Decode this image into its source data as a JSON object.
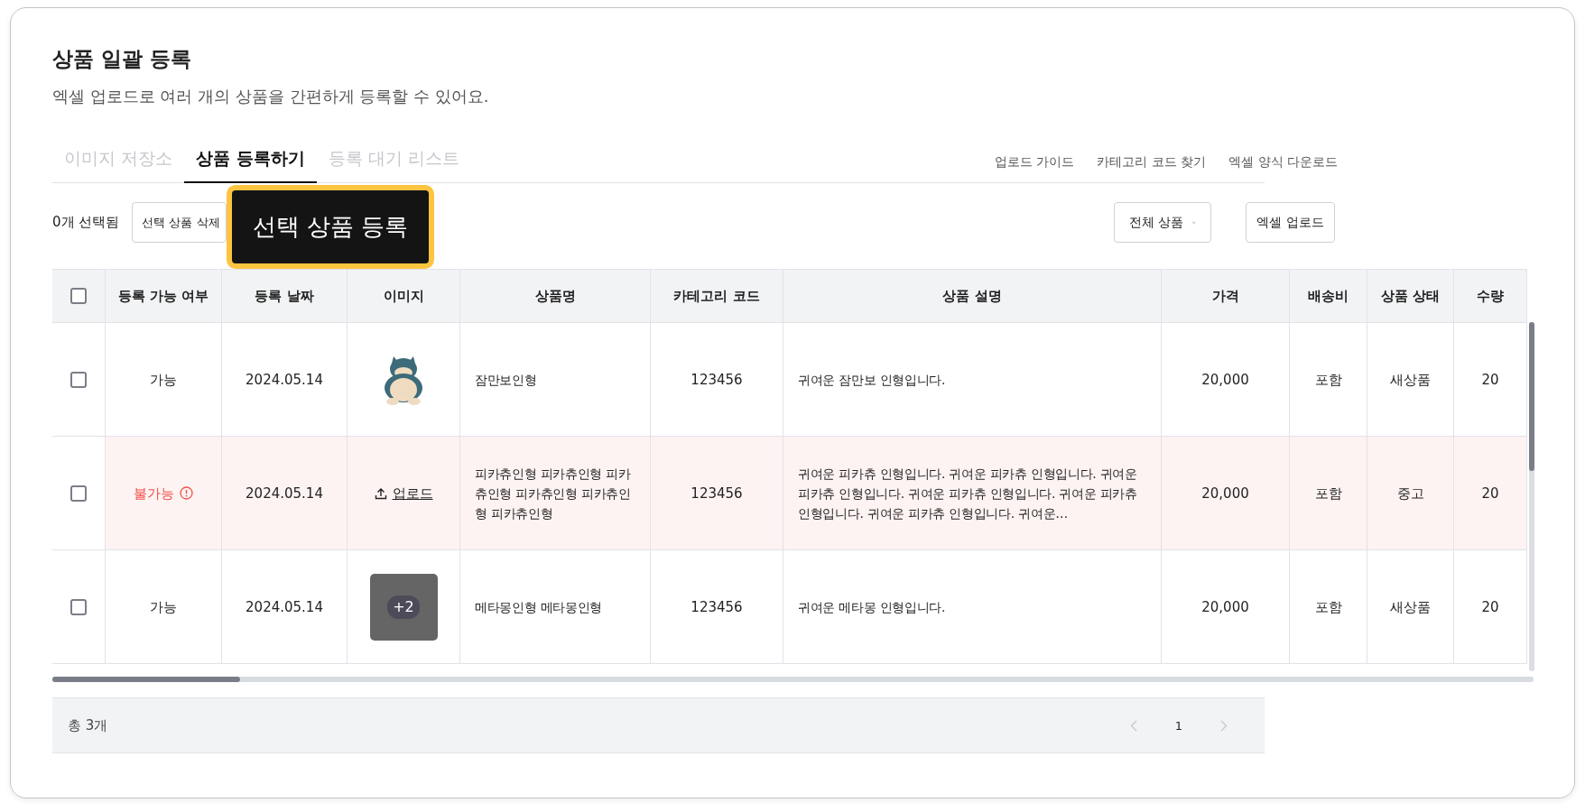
{
  "title": "상품 일괄 등록",
  "subtitle": "엑셀 업로드로 여러 개의 상품을 간편하게 등록할 수 있어요.",
  "tabs": [
    {
      "label": "이미지 저장소",
      "selected": false
    },
    {
      "label": "상품 등록하기",
      "selected": true
    },
    {
      "label": "등록 대기 리스트",
      "selected": false
    }
  ],
  "links": [
    "업로드 가이드",
    "카테고리 코드 찾기",
    "엑셀 양식 다운로드"
  ],
  "selection_count": "0개 선택됨",
  "delete_button": "선택 상품 삭제",
  "register_button": "선택 상품 등록",
  "filter_dropdown": "전체 상품",
  "upload_button": "엑셀 업로드",
  "table": {
    "select_all_checked": false,
    "columns": [
      "등록 가능 여부",
      "등록 날짜",
      "이미지",
      "상품명",
      "카테고리 코드",
      "상품 설명",
      "가격",
      "배송비",
      "상품 상태",
      "수량"
    ],
    "rows": [
      {
        "checked": false,
        "status": "가능",
        "error": false,
        "date": "2024.05.14",
        "image": {
          "kind": "photo"
        },
        "name": "잠만보인형",
        "category_code": "123456",
        "description": "귀여운 잠만보 인형입니다.",
        "price": "20,000",
        "shipping": "포함",
        "condition": "새상품",
        "quantity": "20"
      },
      {
        "checked": false,
        "status": "불가능",
        "error": true,
        "date": "2024.05.14",
        "image": {
          "kind": "upload",
          "label": "업로드"
        },
        "name": "피카츄인형 피카츄인형 피카츄인형 피카츄인형 피카츄인형 피카츄인형",
        "category_code": "123456",
        "description": "귀여운 피카츄 인형입니다. 귀여운 피카츄 인형입니다. 귀여운 피카츄 인형입니다. 귀여운 피카츄 인형입니다. 귀여운 피카츄 인형입니다. 귀여운 피카츄 인형입니다. 귀여운…",
        "price": "20,000",
        "shipping": "포함",
        "condition": "중고",
        "quantity": "20"
      },
      {
        "checked": false,
        "status": "가능",
        "error": false,
        "date": "2024.05.14",
        "image": {
          "kind": "thumbnail",
          "label": "+2"
        },
        "name": "메타몽인형 메타몽인형",
        "category_code": "123456",
        "description": "귀여운 메타몽 인형입니다.",
        "price": "20,000",
        "shipping": "포함",
        "condition": "새상품",
        "quantity": "20"
      }
    ]
  },
  "footer": {
    "total": "총 3개",
    "page": "1"
  }
}
